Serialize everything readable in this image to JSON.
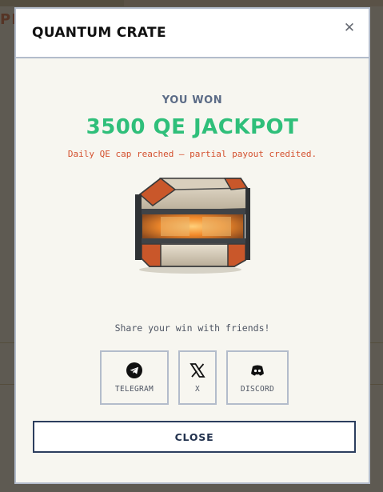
{
  "background": {
    "partial_heading": "PE"
  },
  "modal": {
    "title": "QUANTUM CRATE",
    "close_icon": "close-icon"
  },
  "reward": {
    "heading": "YOU WON",
    "amount": "3500 QE JACKPOT",
    "note": "Daily QE cap reached — partial payout credited.",
    "image": "quantum-crate-image"
  },
  "share": {
    "prompt": "Share your win with friends!",
    "buttons": [
      {
        "label": "TELEGRAM",
        "icon": "telegram-icon"
      },
      {
        "label": "X",
        "icon": "x-logo-icon"
      },
      {
        "label": "DISCORD",
        "icon": "discord-icon"
      }
    ]
  },
  "actions": {
    "close_label": "CLOSE"
  },
  "colors": {
    "accent_green": "#2fbf7a",
    "note_red": "#d4502e",
    "border": "#b3bccb",
    "close_border": "#2c3e5e"
  }
}
